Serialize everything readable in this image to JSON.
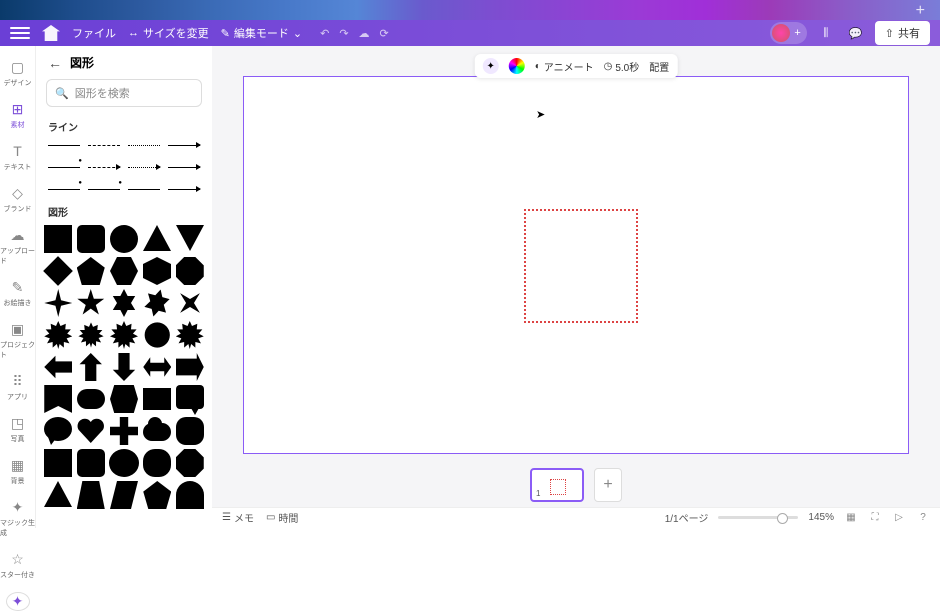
{
  "menubar": {
    "file": "ファイル",
    "resize": "サイズを変更",
    "edit_mode": "編集モード",
    "share": "共有"
  },
  "rail": {
    "design": "デザイン",
    "elements": "素材",
    "text": "テキスト",
    "brand": "ブランド",
    "upload": "アップロード",
    "draw": "お絵描き",
    "projects": "プロジェクト",
    "apps": "アプリ",
    "photos": "写真",
    "bg": "背景",
    "magic": "マジック生成",
    "starred": "スター付き"
  },
  "panel": {
    "title": "図形",
    "search_placeholder": "図形を検索",
    "section_lines": "ライン",
    "section_shapes": "図形"
  },
  "context": {
    "animate": "アニメート",
    "duration": "5.0秒",
    "position": "配置"
  },
  "thumbs": {
    "page1": "1"
  },
  "footer": {
    "notes": "メモ",
    "duration": "時間",
    "pages": "1/1ページ",
    "zoom": "145%"
  }
}
